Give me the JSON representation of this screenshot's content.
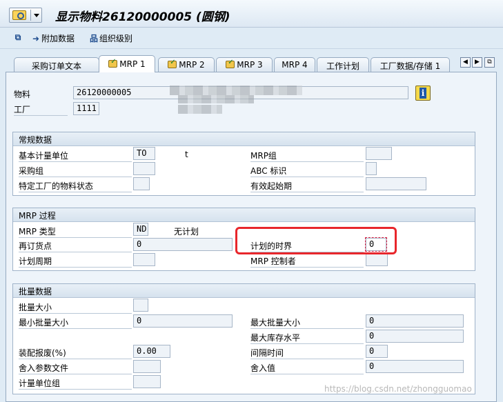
{
  "title": "显示物料26120000005 (圆钢)",
  "toolbar": {
    "additional_data": "附加数据",
    "org_levels": "组织级别"
  },
  "tabs": [
    "采购订单文本",
    "MRP 1",
    "MRP 2",
    "MRP 3",
    "MRP 4",
    "工作计划",
    "工厂数据/存储 1"
  ],
  "header": {
    "material_label": "物料",
    "material_value": "26120000005",
    "plant_label": "工厂",
    "plant_value": "1111"
  },
  "general": {
    "title": "常规数据",
    "base_uom_label": "基本计量单位",
    "base_uom_value": "TO",
    "base_uom_text": "t",
    "mrp_group_label": "MRP组",
    "mrp_group_value": "",
    "purch_group_label": "采购组",
    "purch_group_value": "",
    "abc_label": "ABC 标识",
    "abc_value": "",
    "plant_status_label": "特定工厂的物料状态",
    "plant_status_value": "",
    "valid_from_label": "有效起始期",
    "valid_from_value": ""
  },
  "mrp": {
    "title": "MRP 过程",
    "type_label": "MRP 类型",
    "type_value": "ND",
    "type_text": "无计划",
    "reorder_label": "再订货点",
    "reorder_value": "0",
    "fence_label": "计划的时界",
    "fence_value": "0",
    "cycle_label": "计划周期",
    "cycle_value": "",
    "controller_label": "MRP 控制者",
    "controller_value": ""
  },
  "lot": {
    "title": "批量数据",
    "lot_size_label": "批量大小",
    "lot_size_value": "",
    "min_lot_label": "最小批量大小",
    "min_lot_value": "0",
    "max_lot_label": "最大批量大小",
    "max_lot_value": "0",
    "max_stock_label": "最大库存水平",
    "max_stock_value": "0",
    "scrap_label": "装配报废(%)",
    "scrap_value": "0.00",
    "interval_label": "间隔时间",
    "interval_value": "0",
    "rounding_profile_label": "舍入参数文件",
    "rounding_profile_value": "",
    "rounding_value_label": "舍入值",
    "rounding_value_value": "0",
    "uom_group_label": "计量单位组",
    "uom_group_value": ""
  },
  "watermark": "https://blog.csdn.net/zhongguomao"
}
